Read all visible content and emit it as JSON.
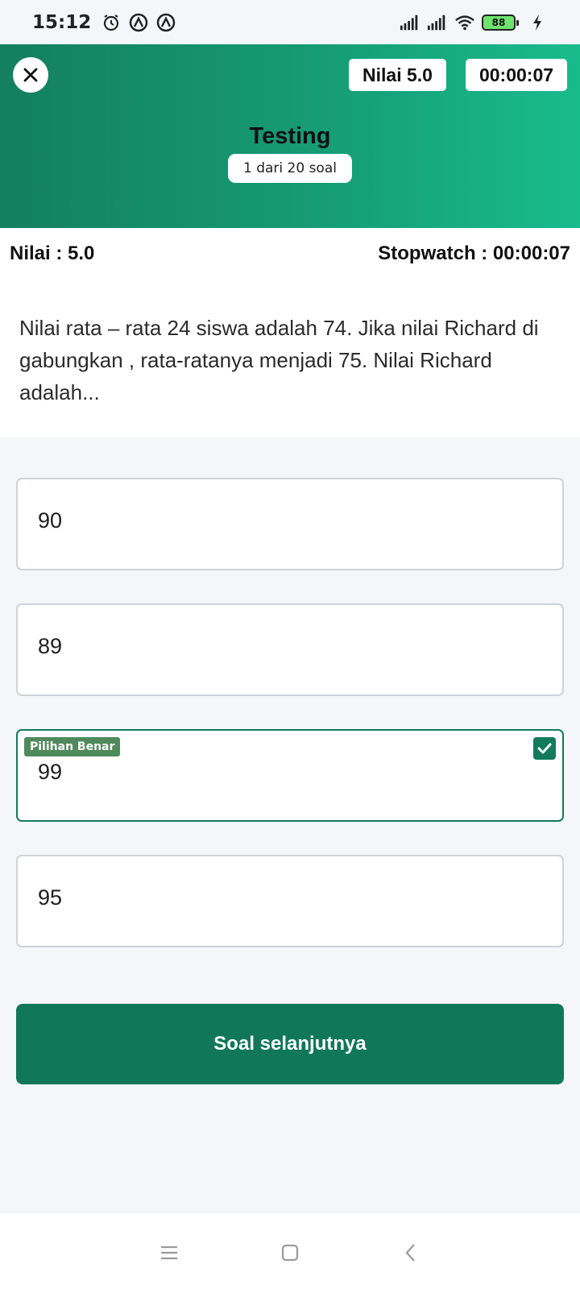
{
  "status_bar": {
    "time": "15:12",
    "battery": "88",
    "icons": [
      "alarm-icon",
      "app-notification-icon",
      "app-notification-icon",
      "signal-icon",
      "signal-icon",
      "wifi-icon",
      "battery-icon",
      "charging-icon"
    ]
  },
  "header": {
    "score_chip": "Nilai 5.0",
    "timer_chip": "00:00:07",
    "title": "Testing",
    "subtitle": "1 dari 20 soal"
  },
  "info": {
    "score": "Nilai : 5.0",
    "stopwatch": "Stopwatch : 00:00:07"
  },
  "question": {
    "text": "Nilai rata – rata 24 siswa adalah 74. Jika nilai Richard di gabungkan , rata-ratanya  menjadi 75. Nilai Richard adalah..."
  },
  "options": [
    {
      "text": "90"
    },
    {
      "text": "89"
    },
    {
      "text": "99",
      "label": "Pilihan Benar",
      "checked": true
    },
    {
      "text": "95"
    }
  ],
  "next_button": "Soal selanjutnya",
  "colors": {
    "accent": "#107858",
    "header_gradient_start": "#137f5d",
    "header_gradient_end": "#18bb8c",
    "correct_label": "#4f8a5c"
  }
}
